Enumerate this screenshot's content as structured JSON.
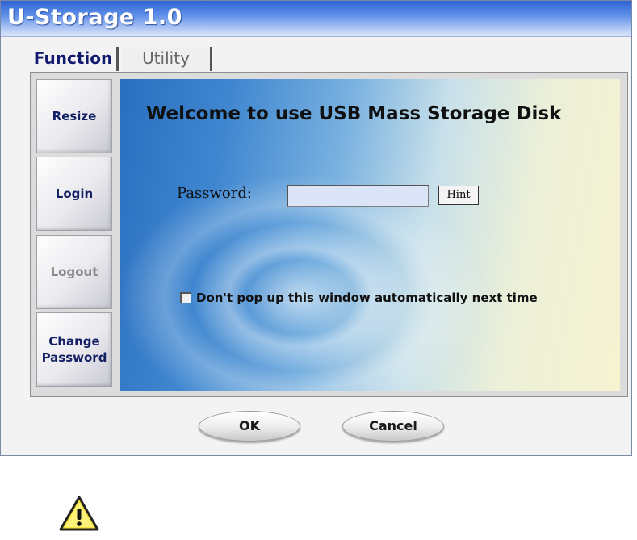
{
  "window": {
    "title": "U-Storage 1.0"
  },
  "tabs": [
    {
      "label": "Function"
    },
    {
      "label": "Utility"
    }
  ],
  "sidebar": {
    "items": [
      {
        "label": "Resize"
      },
      {
        "label": "Login"
      },
      {
        "label": "Logout"
      },
      {
        "label": "Change\nPassword"
      }
    ]
  },
  "main": {
    "welcome": "Welcome to use USB Mass Storage Disk",
    "password_label": "Password:",
    "password_value": "",
    "hint_label": "Hint",
    "checkbox_label": "Don't pop up this window automatically next time",
    "checkbox_checked": false
  },
  "footer": {
    "ok_label": "OK",
    "cancel_label": "Cancel"
  },
  "icons": {
    "warning": "warning-icon"
  },
  "colors": {
    "title_bar": "#2f63d4",
    "tab_active_text": "#111a6e",
    "sidebar_text": "#132064"
  }
}
